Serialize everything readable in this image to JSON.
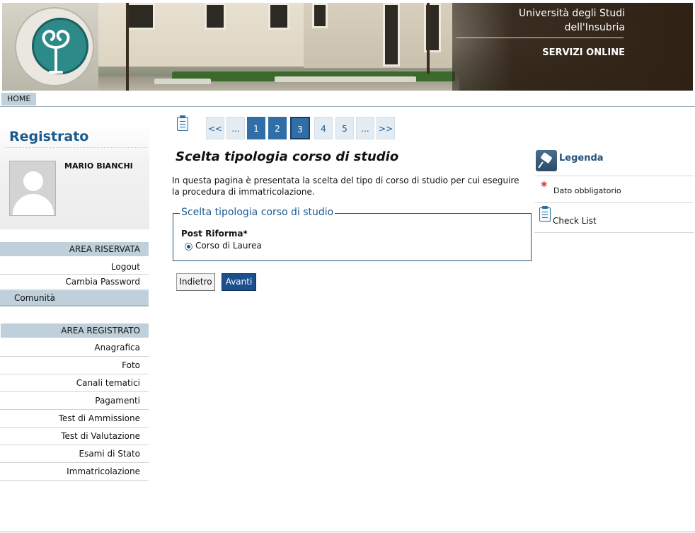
{
  "header": {
    "university_line1": "Università degli Studi",
    "university_line2": "dell'Insubria",
    "services": "SERVIZI ONLINE",
    "seal_text": "UNIVERSITAS STUDIORUM INSUBRIAE",
    "logo_icon": "university-seal-icon"
  },
  "topnav": {
    "home": "HOME"
  },
  "sidebar": {
    "title": "Registrato",
    "user_name": "MARIO BIANCHI",
    "avatar_icon": "user-avatar-icon",
    "reserved_area": {
      "heading": "AREA RISERVATA",
      "items": [
        "Logout",
        "Cambia Password",
        "Comunità"
      ]
    },
    "registered_area": {
      "heading": "AREA REGISTRATO",
      "items": [
        "Anagrafica",
        "Foto",
        "Canali tematici",
        "Pagamenti",
        "Test di Ammissione",
        "Test di Valutazione",
        "Esami di Stato",
        "Immatricolazione"
      ]
    }
  },
  "pager": {
    "first": "<<",
    "ellipsis_before": "...",
    "pages": [
      "1",
      "2",
      "3",
      "4",
      "5"
    ],
    "current": "3",
    "ellipsis_after": "...",
    "last": ">>"
  },
  "main": {
    "title": "Scelta tipologia corso di studio",
    "intro": "In questa pagina è presentata la scelta del tipo di corso di studio per cui eseguire la procedura di immatricolazione.",
    "fieldset_legend": "Scelta tipologia corso di studio",
    "field_label": "Post Riforma*",
    "radio_option": "Corso di Laurea",
    "radio_selected": true,
    "back_button": "Indietro",
    "next_button": "Avanti"
  },
  "legend": {
    "title": "Legenda",
    "required": "Dato obbligatorio",
    "checklist": "Check List",
    "icons": [
      "pin-icon",
      "asterisk-icon",
      "clipboard-icon"
    ]
  },
  "colors": {
    "accent_blue": "#1b5a8e",
    "menu_bar": "#bfd0da",
    "pager_active": "#2f6ea6",
    "required_red": "#d42a2a"
  }
}
